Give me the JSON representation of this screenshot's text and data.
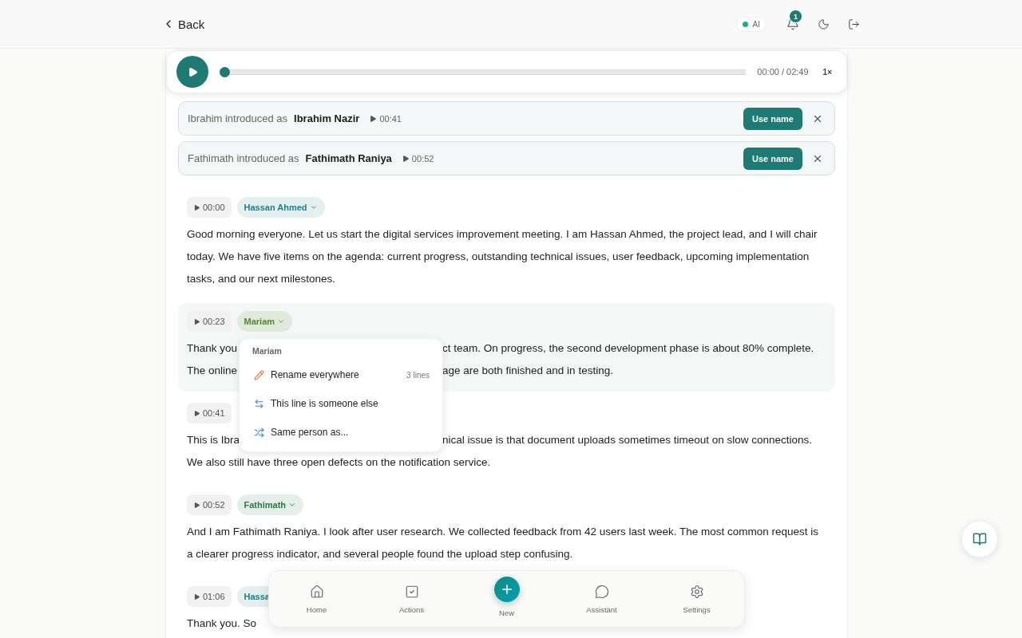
{
  "top_bar": {
    "back": "Back",
    "ai_badge": "AI",
    "notifications": "1"
  },
  "player": {
    "time": "00:00 / 02:49",
    "speed": "1×",
    "level": 0
  },
  "suggestions": [
    {
      "speaker": "Ibrahim",
      "text": "introduced as",
      "name": "Ibrahim Nazir",
      "time": "00:41",
      "action": "Use name"
    },
    {
      "speaker": "Fathimath",
      "text": "introduced as",
      "name": "Fathimath Raniya",
      "time": "00:52",
      "action": "Use name"
    }
  ],
  "segments": [
    {
      "time": "00:00",
      "speaker": "Hassan Ahmed",
      "color": "#1f7f86",
      "dropdown": true,
      "highlighted": false,
      "lines": [
        [
          "Good morning everyone. Let us start the digital services improvement meeting. I am Hassan Ahmed, the project lead, and I will chair today. We have five items on the agenda: current progress, outstanding technical issues, user feedback, upcoming implementation tasks, and our next milestones."
        ]
      ]
    },
    {
      "time": "00:23",
      "speaker": "Mariam",
      "color": "#4f8a2a",
      "dropdown": true,
      "highlighted": true,
      "lines": [
        [
          "Thank you",
          "ct team. On progress, the second development phase is about 80% complete."
        ],
        [
          "The online",
          "age are both finished and in testing."
        ]
      ],
      "menu": {
        "title": "Mariam",
        "items": [
          {
            "kind": "rename",
            "label": "Rename everywhere",
            "count": "3 lines"
          },
          {
            "kind": "reassign",
            "label": "This line is someone else"
          },
          {
            "kind": "merge",
            "label": "Same person as..."
          }
        ]
      }
    },
    {
      "time": "00:41",
      "highlighted": false,
      "lines": [
        [
          "This is Ibra",
          "nical issue is that document uploads sometimes timeout on slow connections."
        ],
        [
          "We also still have three open defects on the notification service."
        ]
      ]
    },
    {
      "time": "00:52",
      "speaker": "Fathimath",
      "color": "#2a7a45",
      "dropdown": true,
      "highlighted": false,
      "lines": [
        [
          "And I am Fathimath Raniya. I look after user research. We collected feedback from 42 users last week. The most common request is a clearer progress indicator, and several people found the upload step confusing."
        ]
      ]
    },
    {
      "time": "01:06",
      "speaker": "Hassa",
      "color": "#1f7f86",
      "dropdown": false,
      "highlighted": false,
      "lines": [
        [
          "Thank you. So"
        ]
      ]
    }
  ],
  "nav": [
    {
      "kind": "home",
      "label": "Home"
    },
    {
      "kind": "actions",
      "label": "Actions"
    },
    {
      "kind": "new",
      "label": "New"
    },
    {
      "kind": "assistant",
      "label": "Assistant"
    },
    {
      "kind": "settings",
      "label": "Settings"
    }
  ]
}
